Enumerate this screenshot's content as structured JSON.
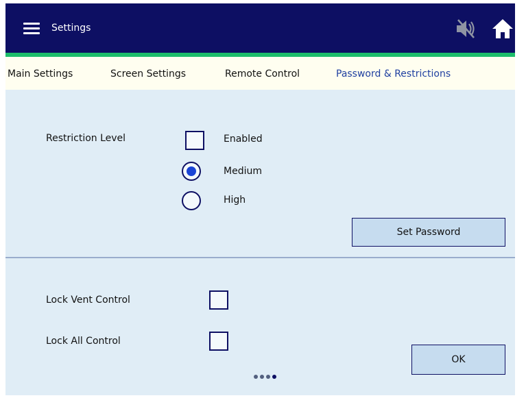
{
  "header": {
    "title": "Settings",
    "menu_icon": "hamburger-menu-icon",
    "mute_icon": "speaker-muted-icon",
    "home_icon": "home-icon"
  },
  "tabs": [
    {
      "label": "Main Settings",
      "active": false
    },
    {
      "label": "Screen Settings",
      "active": false
    },
    {
      "label": "Remote Control",
      "active": false
    },
    {
      "label": "Password & Restrictions",
      "active": true
    }
  ],
  "restriction": {
    "label": "Restriction Level",
    "enabled": {
      "label": "Enabled",
      "checked": false
    },
    "levels": [
      {
        "label": "Medium",
        "selected": true
      },
      {
        "label": "High",
        "selected": false
      }
    ]
  },
  "set_password_label": "Set Password",
  "locks": [
    {
      "label": "Lock Vent Control",
      "checked": false
    },
    {
      "label": "Lock All Control",
      "checked": false
    }
  ],
  "ok_label": "OK",
  "pager": {
    "pages": 4
  },
  "colors": {
    "header": "#0d0f63",
    "accent_bar": "#1dbd6b",
    "tabs_bg": "#fffef0",
    "panel_bg": "#e0edf6",
    "active_tab": "#1f3fa0",
    "radio_dot": "#1a44d6",
    "button_bg": "#c6dcef"
  }
}
